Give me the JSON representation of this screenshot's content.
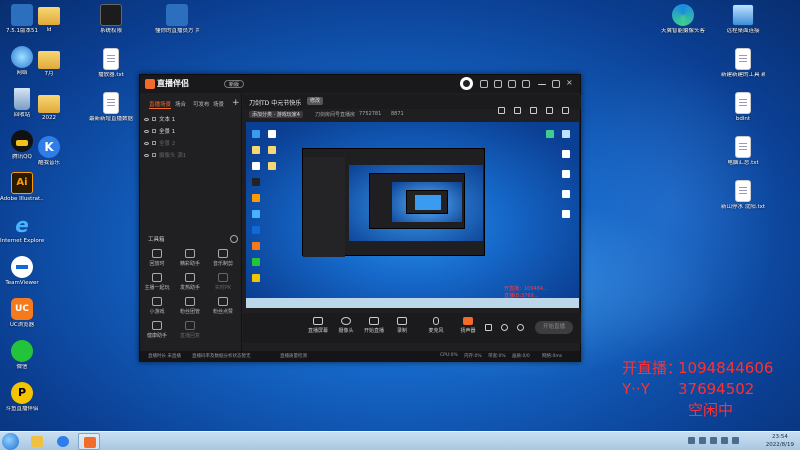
{
  "desktop": {
    "left_icons": [
      {
        "label": "7.5.1版本51",
        "kind": "device"
      },
      {
        "label": "网络",
        "kind": "net"
      },
      {
        "label": "回收站",
        "kind": "bin"
      },
      {
        "label": "腾讯QQ",
        "kind": "qq"
      },
      {
        "label": "Adobe Illustrat...",
        "kind": "ai"
      },
      {
        "label": "Internet Explorer",
        "kind": "ie"
      },
      {
        "label": "TeamViewer",
        "kind": "tv"
      },
      {
        "label": "UC浏览器",
        "kind": "uc"
      },
      {
        "label": "微信",
        "kind": "wx"
      },
      {
        "label": "斗鱼直播伴侣",
        "kind": "dm"
      }
    ],
    "col2_icons": [
      {
        "label": "ld",
        "kind": "folder"
      },
      {
        "label": "7月",
        "kind": "folder"
      },
      {
        "label": "2022",
        "kind": "folder"
      },
      {
        "label": "酷我音乐",
        "kind": "kbrw"
      }
    ],
    "col3_icons": [
      {
        "label": "系统权限",
        "kind": "studio"
      },
      {
        "label": "播放器.txt",
        "kind": "doc"
      },
      {
        "label": "最新新增直播数据006-17...",
        "kind": "doc"
      }
    ],
    "col4_icons": [
      {
        "label": "懂你的直播员方\n共赢平台",
        "kind": "device"
      }
    ],
    "right_icons": [
      {
        "label": "天翼智能摄像头客户端",
        "kind": "edge"
      },
      {
        "label": "远程桌面连接",
        "kind": "pc"
      },
      {
        "label": "新建新建的工具\n新工.txt",
        "kind": "doc"
      },
      {
        "label": "bdlnt",
        "kind": "doc"
      },
      {
        "label": "电脑汇总.txt",
        "kind": "doc"
      },
      {
        "label": "新山停水\n沈阳.txt",
        "kind": "doc"
      }
    ]
  },
  "app": {
    "logo": "直播伴侣",
    "version": "新版",
    "tabs": [
      "直播场景",
      "场合",
      "可发布",
      "场景"
    ],
    "scenes": [
      {
        "name": "文本 1",
        "dim": false
      },
      {
        "name": "全景 1",
        "dim": false
      },
      {
        "name": "全景 2",
        "dim": true
      },
      {
        "name": "摄像头 源1",
        "dim": true
      }
    ],
    "tools_title": "工具箱",
    "tools": [
      {
        "label": "回放时",
        "dim": false
      },
      {
        "label": "精彩助手",
        "dim": false
      },
      {
        "label": "音乐制剪",
        "dim": false
      },
      {
        "label": "主播一起玩",
        "dim": false
      },
      {
        "label": "发热助手",
        "dim": false
      },
      {
        "label": "实时PK",
        "dim": true
      },
      {
        "label": "小游戏",
        "dim": false
      },
      {
        "label": "粉丝团管",
        "dim": false
      },
      {
        "label": "粉丝点赞",
        "dim": false
      },
      {
        "label": "健康助手",
        "dim": false
      },
      {
        "label": "直播回复",
        "dim": true
      }
    ],
    "room_title": "刀剑TD 中元节快乐",
    "room_tag": "修改",
    "info": {
      "category": "添加分类 · 游戏玩家4",
      "id_label": "刀剑房间号直播房",
      "id_value": "7752781",
      "viewers": "8871"
    },
    "preview_red_text": "开直播：109484...\n直播ID:3769...\n空闲中",
    "bottom_buttons": [
      "直播屏幕",
      "摄像头",
      "开始直播",
      "录制",
      "麦克风",
      "扬声器"
    ],
    "go_live": "开始直播",
    "status": [
      "直播时长 未直播",
      "直播码率及数据分析状态暂无",
      "直播质量检测",
      "CPU:0%",
      "内存:0%",
      "带宽:0%",
      "画质:0/0",
      "网络:0ms"
    ]
  },
  "overlay": {
    "qq_label": "开直播：",
    "qq_value": "1094844606",
    "yy_label": "Y··Y",
    "yy_value": "37694502",
    "status": "空闲中"
  },
  "taskbar": {
    "time": "23:54",
    "date": "2022/8/19"
  },
  "colors": {
    "accent": "#f26b2b",
    "overlay_red": "#ff3030",
    "window_bg": "#1f1f21"
  }
}
